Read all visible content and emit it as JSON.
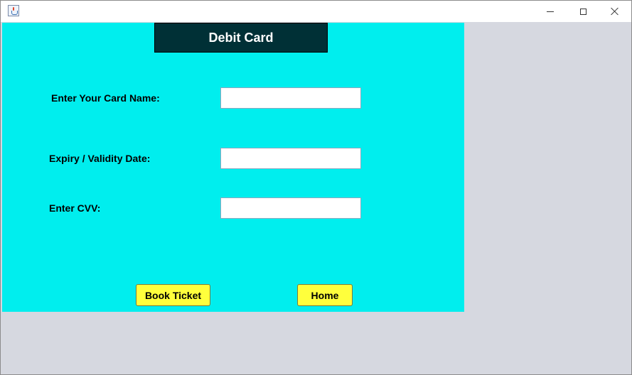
{
  "window": {
    "title": "",
    "controls": [
      "minimize-icon",
      "maximize-icon",
      "close-icon"
    ]
  },
  "form": {
    "heading": "Debit Card",
    "fields": [
      {
        "label": "Enter Your Card Name:",
        "value": "",
        "placeholder": ""
      },
      {
        "label": "Expiry / Validity Date:",
        "value": "",
        "placeholder": ""
      },
      {
        "label": "Enter CVV:",
        "value": "",
        "placeholder": ""
      }
    ],
    "buttons": {
      "book_ticket": "Book Ticket",
      "home": "Home"
    }
  },
  "colors": {
    "panel_background": "#00eeee",
    "heading_background": "#003036",
    "heading_text": "#ffffff",
    "button_background": "#ffff3c",
    "window_background": "#d6d8e0"
  }
}
